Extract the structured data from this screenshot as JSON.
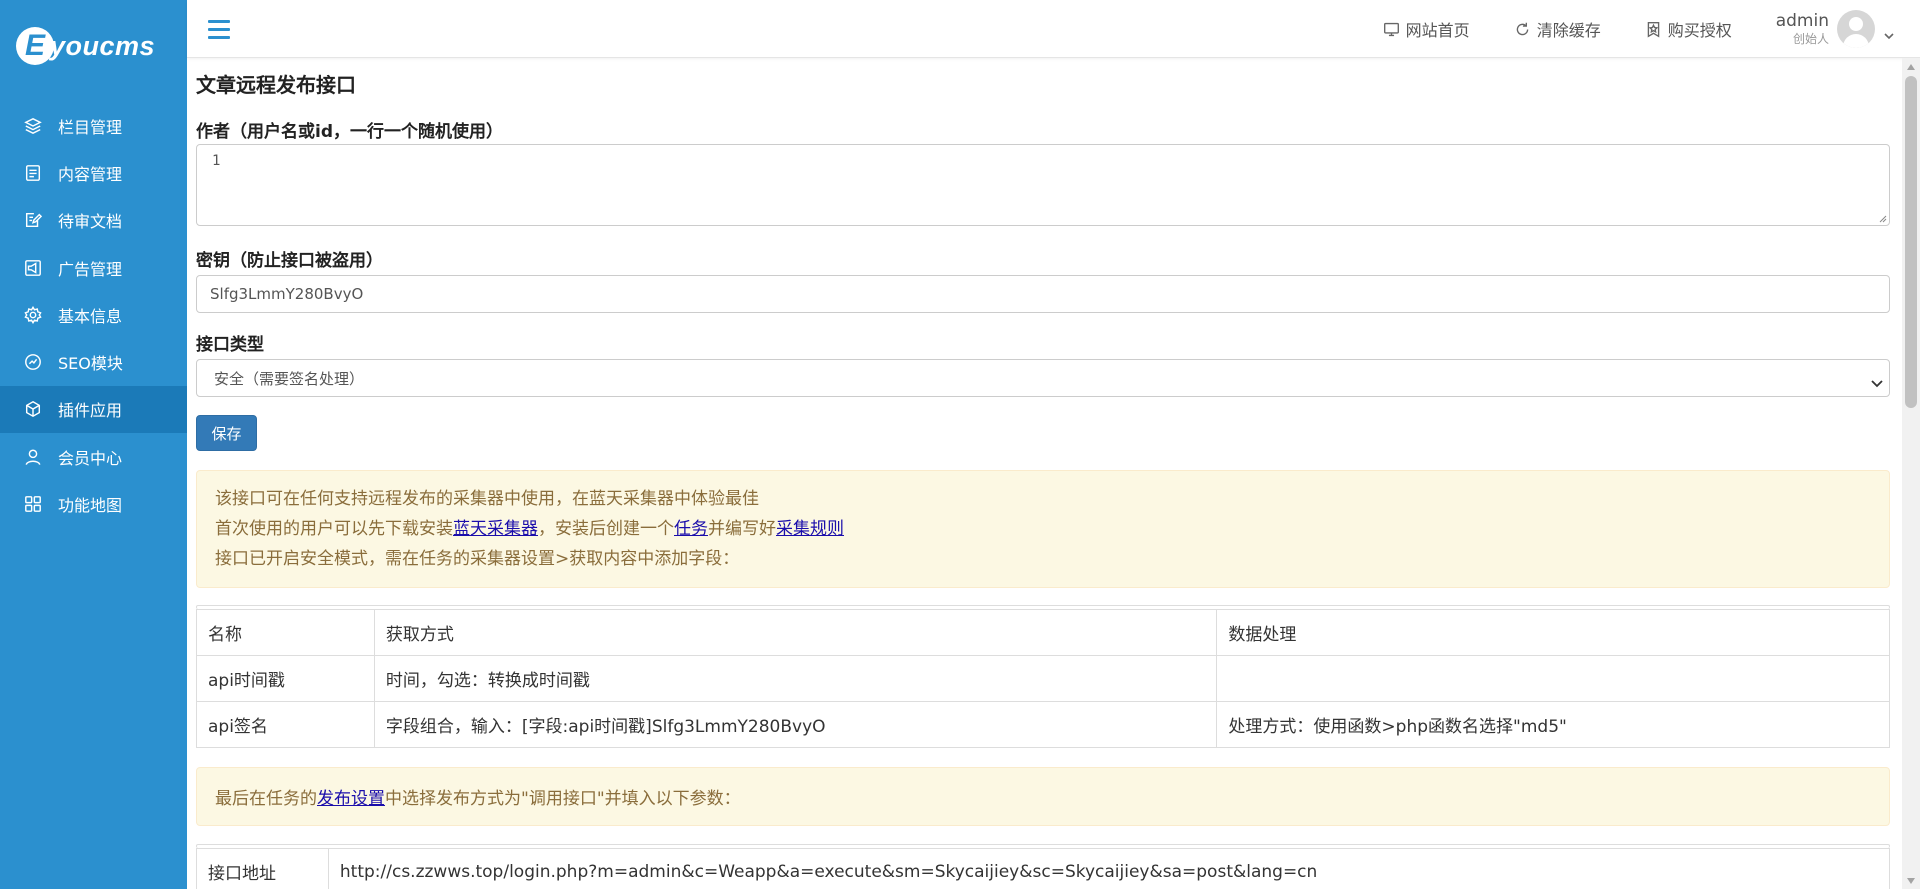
{
  "brand": {
    "logo_letter": "E",
    "logo_text": "youcms"
  },
  "sidebar": {
    "items": [
      {
        "label": "栏目管理",
        "icon": "layers-icon"
      },
      {
        "label": "内容管理",
        "icon": "document-list-icon"
      },
      {
        "label": "待审文档",
        "icon": "edit-document-icon"
      },
      {
        "label": "广告管理",
        "icon": "megaphone-icon"
      },
      {
        "label": "基本信息",
        "icon": "gear-icon"
      },
      {
        "label": "SEO模块",
        "icon": "seo-badge-icon"
      },
      {
        "label": "插件应用",
        "icon": "cube-icon",
        "active": true
      },
      {
        "label": "会员中心",
        "icon": "user-icon"
      },
      {
        "label": "功能地图",
        "icon": "grid-map-icon"
      }
    ]
  },
  "header": {
    "links": [
      {
        "label": "网站首页",
        "icon": "monitor-icon"
      },
      {
        "label": "清除缓存",
        "icon": "refresh-icon"
      },
      {
        "label": "购买授权",
        "icon": "license-badge-icon"
      }
    ],
    "user": {
      "name": "admin",
      "role": "创始人"
    }
  },
  "form": {
    "title": "文章远程发布接口",
    "author_label": "作者（用户名或id，一行一个随机使用）",
    "author_value": "1",
    "key_label": "密钥（防止接口被盗用）",
    "key_value": "Slfg3LmmY280BvyO",
    "type_label": "接口类型",
    "type_selected": "安全（需要签名处理）",
    "save_label": "保存"
  },
  "notice1": {
    "line1": "该接口可在任何支持远程发布的采集器中使用，在蓝天采集器中体验最佳",
    "line2_a": "首次使用的用户可以先下载安装",
    "line2_link1": "蓝天采集器",
    "line2_b": "，安装后创建一个",
    "line2_link2": "任务",
    "line2_c": "并编写好",
    "line2_link3": "采集规则",
    "line3": "接口已开启安全模式，需在任务的采集器设置>获取内容中添加字段："
  },
  "fields_table": {
    "headers": [
      "名称",
      "获取方式",
      "数据处理"
    ],
    "rows": [
      [
        "api时间戳",
        "时间，勾选：转换成时间戳",
        ""
      ],
      [
        "api签名",
        "字段组合，输入：[字段:api时间戳]Slfg3LmmY280BvyO",
        "处理方式：使用函数>php函数名选择\"md5\""
      ]
    ]
  },
  "notice2": {
    "text_a": "最后在任务的",
    "link": "发布设置",
    "text_b": "中选择发布方式为\"调用接口\"并填入以下参数："
  },
  "params_table": {
    "rows": [
      [
        "接口地址",
        "http://cs.zzwws.top/login.php?m=admin&c=Weapp&a=execute&sm=Skycaijiey&sc=Skycaijiey&sa=post&lang=cn"
      ]
    ]
  },
  "colors": {
    "sidebar_bg": "#2b90cf",
    "sidebar_active": "#1b7ab8",
    "primary_button": "#337ab7",
    "notice_bg": "#fcf8e3",
    "notice_text": "#8a6d3b"
  }
}
